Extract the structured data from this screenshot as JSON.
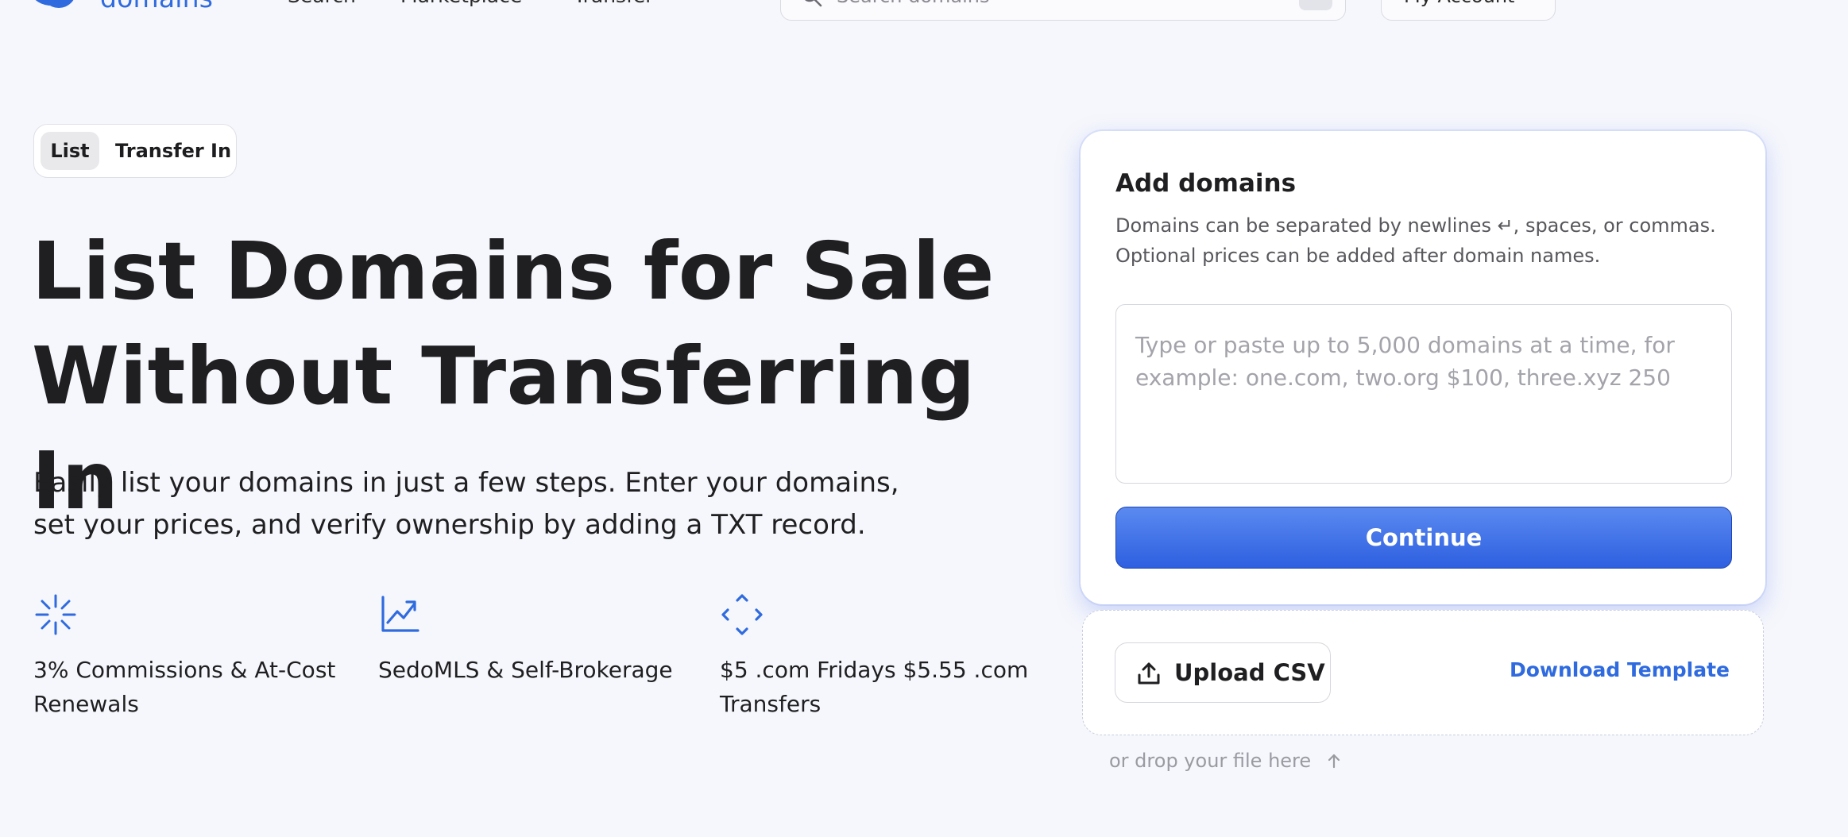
{
  "header": {
    "brand": "domains",
    "nav": [
      "Search",
      "Marketplace",
      "Transfer"
    ],
    "search_placeholder": "Search domains",
    "account_label": "My Account",
    "icons": [
      "user-icon",
      "tag-icon",
      "cart-icon"
    ]
  },
  "mode_tabs": {
    "active": "List",
    "other": "Transfer In"
  },
  "hero": {
    "headline_line1": "List Domains for Sale",
    "headline_line2": "Without Transferring In",
    "subline_line1": "Easily list your domains in just a few steps. Enter your domains,",
    "subline_line2": "set your prices, and verify ownership by adding a TXT record."
  },
  "features": [
    {
      "icon": "sparkle-icon",
      "line1": "3% Commissions & At-Cost",
      "line2": "Renewals"
    },
    {
      "icon": "trend-chart-icon",
      "line1": "SedoMLS & Self-Brokerage",
      "line2": ""
    },
    {
      "icon": "diamond-arrows-icon",
      "line1": "$5 .com Fridays $5.55 .com",
      "line2": "Transfers"
    }
  ],
  "add_domains": {
    "title": "Add domains",
    "desc_line1": "Domains can be separated by newlines ↵, spaces, or commas.",
    "desc_line2": "Optional prices can be added after domain names.",
    "textarea_value": "",
    "textarea_placeholder": "Type or paste up to 5,000 domains at a time, for example: one.com, two.org $100, three.xyz 250",
    "continue_label": "Continue"
  },
  "upload": {
    "upload_label": "Upload CSV",
    "download_label": "Download Template",
    "drop_hint": "or drop your file here"
  },
  "colors": {
    "accent": "#2f6bdf",
    "background": "#f6f7fc",
    "button_gradient_top": "#5a8af0",
    "button_gradient_bottom": "#2e5fe0"
  }
}
